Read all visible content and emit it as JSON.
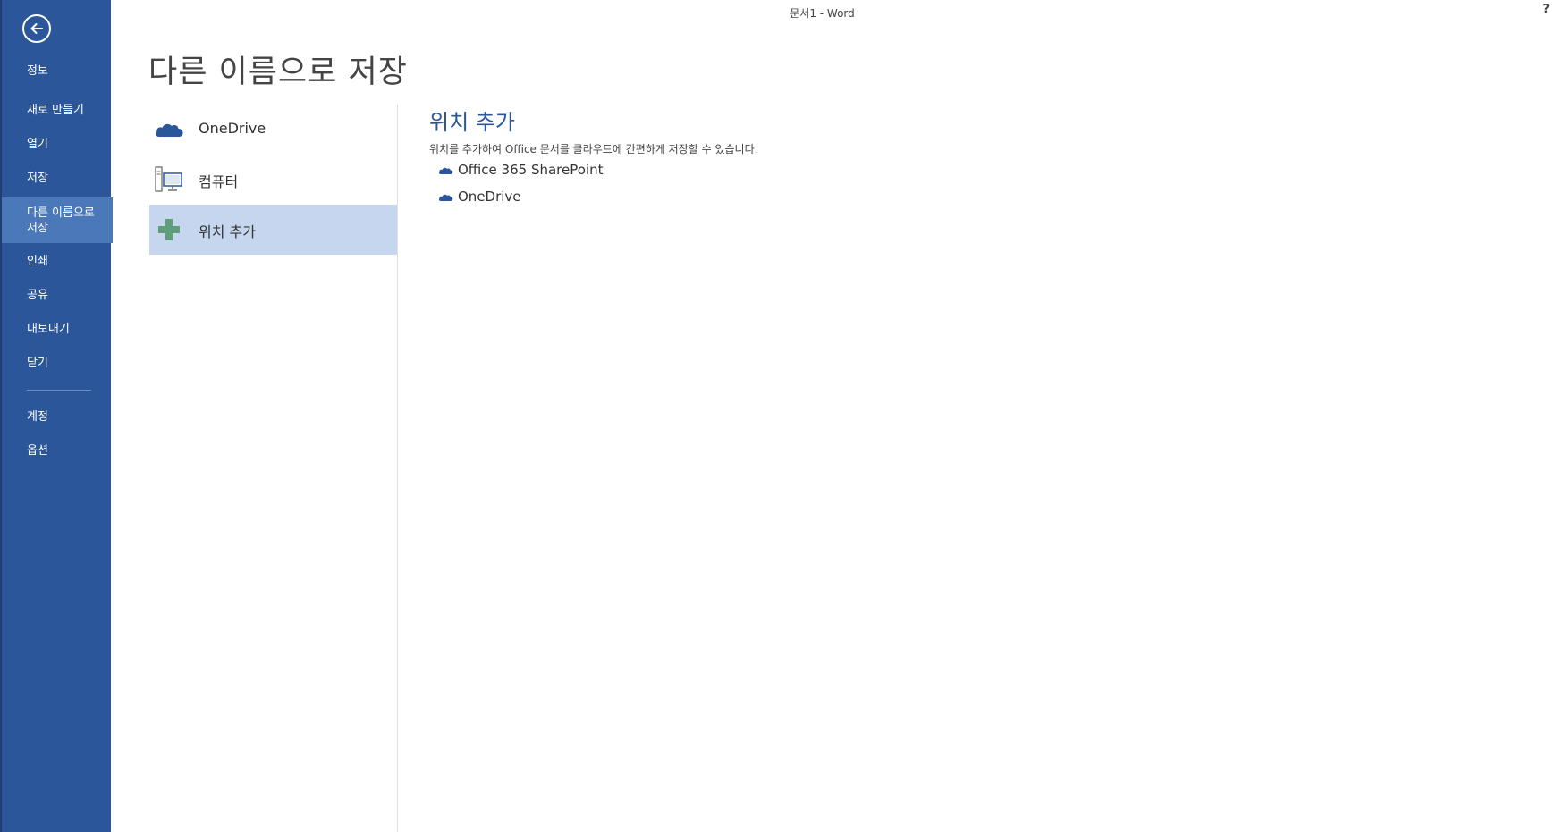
{
  "window": {
    "title": "문서1 - Word",
    "help_label": "?"
  },
  "sidebar": {
    "items": [
      {
        "label": "정보"
      },
      {
        "label": "새로 만들기"
      },
      {
        "label": "열기"
      },
      {
        "label": "저장"
      },
      {
        "label": "다른 이름으로 저장",
        "active": true
      },
      {
        "label": "인쇄"
      },
      {
        "label": "공유"
      },
      {
        "label": "내보내기"
      },
      {
        "label": "닫기"
      },
      {
        "label": "계정"
      },
      {
        "label": "옵션"
      }
    ]
  },
  "main": {
    "title": "다른 이름으로 저장",
    "places": [
      {
        "label": "OneDrive",
        "icon": "onedrive-cloud-icon"
      },
      {
        "label": "컴퓨터",
        "icon": "computer-icon"
      },
      {
        "label": "위치 추가",
        "icon": "plus-icon",
        "active": true
      }
    ],
    "detail": {
      "title": "위치 추가",
      "description": "위치를 추가하여 Office 문서를 클라우드에 간편하게 저장할 수 있습니다.",
      "locations": [
        {
          "label": "Office 365 SharePoint",
          "icon": "cloud-icon"
        },
        {
          "label": "OneDrive",
          "icon": "cloud-icon"
        }
      ]
    }
  },
  "colors": {
    "sidebar_bg": "#2b579a",
    "sidebar_active": "#4a78b8",
    "place_active": "#c5d6ee",
    "accent_text": "#2b579a",
    "plus_green": "#5e9e7b"
  }
}
